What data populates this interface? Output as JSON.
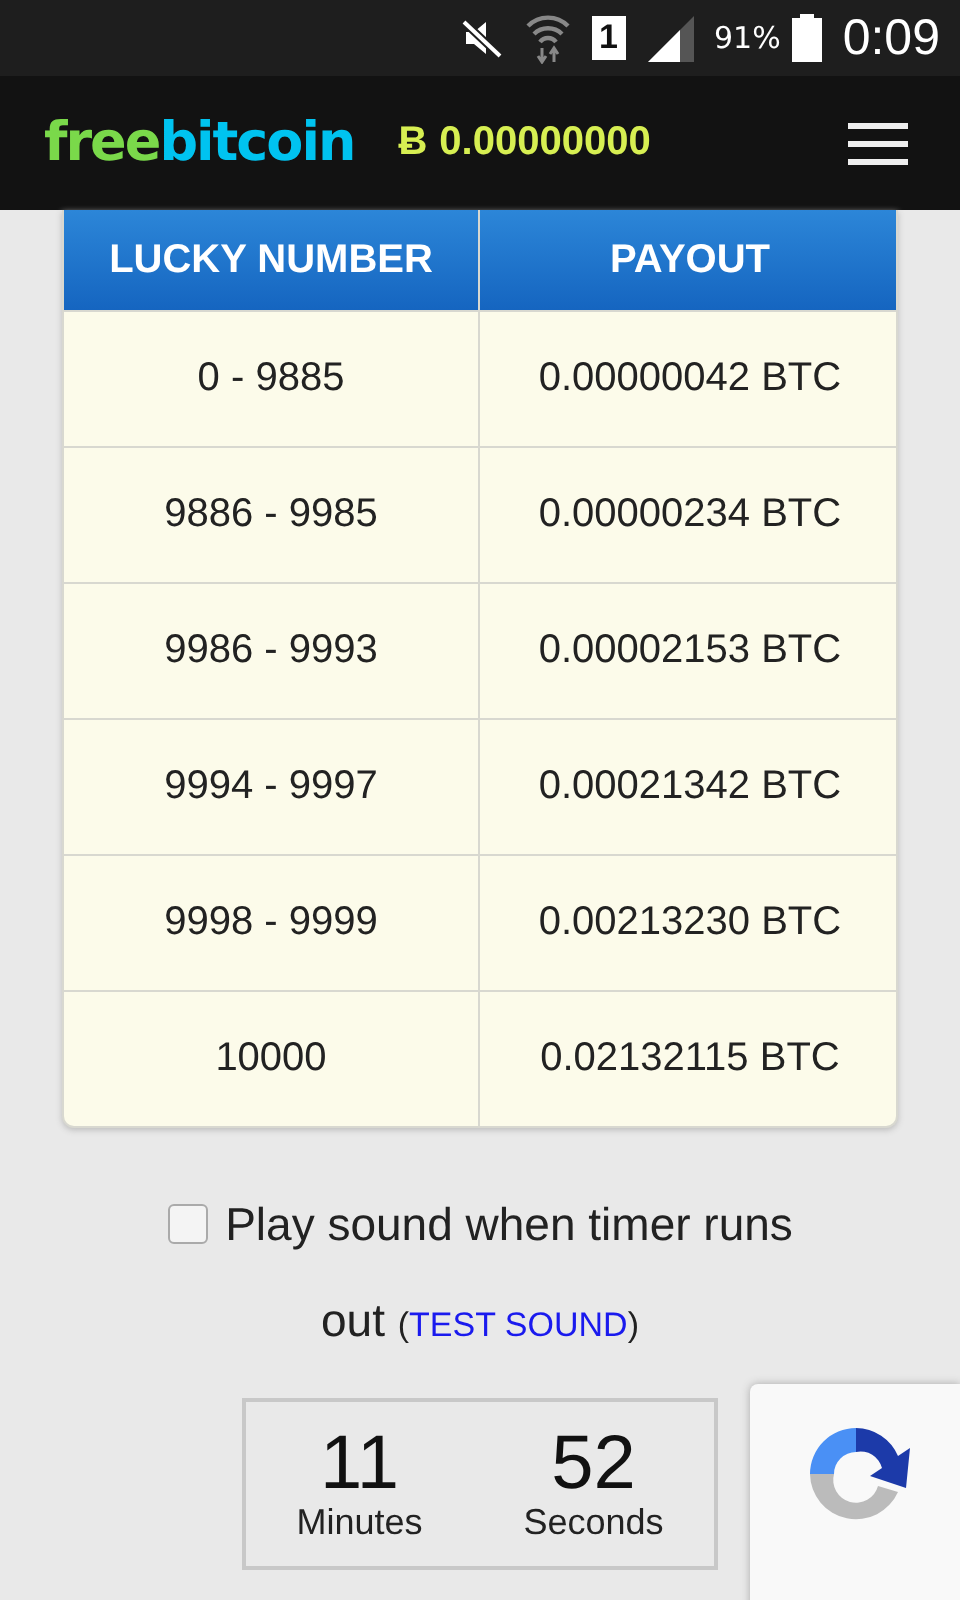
{
  "status_bar": {
    "sim": "1",
    "battery_text": "91%",
    "time": "0:09"
  },
  "header": {
    "logo": [
      "free",
      "bitcoin"
    ],
    "currency_symbol": "Ƀ",
    "balance": "0.00000000"
  },
  "table": {
    "columns": [
      "LUCKY NUMBER",
      "PAYOUT"
    ],
    "rows": [
      [
        "0 - 9885",
        "0.00000042 BTC"
      ],
      [
        "9886 - 9985",
        "0.00000234 BTC"
      ],
      [
        "9986 - 9993",
        "0.00002153 BTC"
      ],
      [
        "9994 - 9997",
        "0.00021342 BTC"
      ],
      [
        "9998 - 9999",
        "0.00213230 BTC"
      ],
      [
        "10000",
        "0.02132115 BTC"
      ]
    ]
  },
  "sound_option": {
    "checked": false,
    "label": "Play sound when timer runs out",
    "link_open": "(",
    "link": "TEST SOUND",
    "link_close": ")"
  },
  "timer": [
    {
      "value": "11",
      "unit": "Minutes"
    },
    {
      "value": "52",
      "unit": "Seconds"
    }
  ]
}
